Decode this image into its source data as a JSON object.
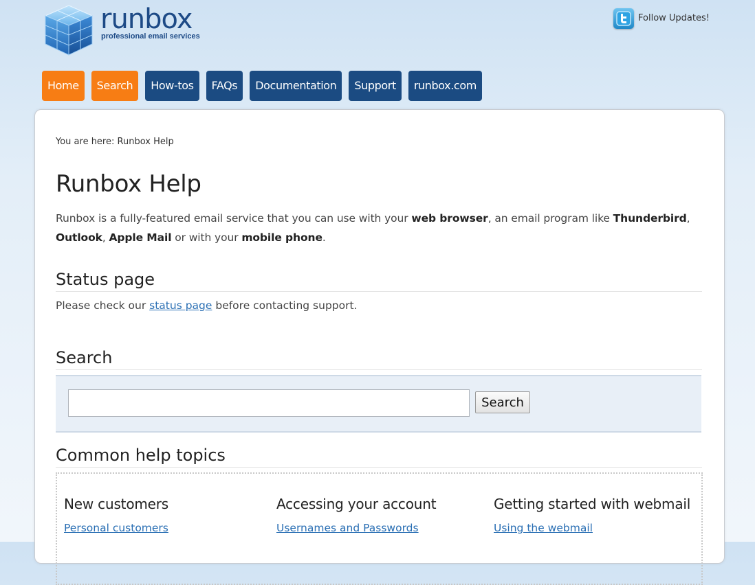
{
  "header": {
    "logo_word": "runbox",
    "logo_tagline": "professional email services",
    "follow_label": "Follow Updates!"
  },
  "nav": {
    "items": [
      {
        "label": "Home",
        "style": "orange"
      },
      {
        "label": "Search",
        "style": "orange"
      },
      {
        "label": "How-tos",
        "style": "blue"
      },
      {
        "label": "FAQs",
        "style": "blue"
      },
      {
        "label": "Documentation",
        "style": "blue"
      },
      {
        "label": "Support",
        "style": "blue"
      },
      {
        "label": "runbox.com",
        "style": "blue"
      }
    ]
  },
  "breadcrumb": {
    "prefix": "You are here: ",
    "current": "Runbox Help"
  },
  "page": {
    "title": "Runbox Help",
    "intro": {
      "t1": "Runbox is a fully-featured email service that you can use with your ",
      "b1": "web browser",
      "t2": ", an email program like ",
      "b2": "Thunderbird",
      "t3": ", ",
      "b3": "Outlook",
      "t4": ", ",
      "b4": "Apple Mail",
      "t5": " or with your ",
      "b5": "mobile phone",
      "t6": "."
    }
  },
  "status": {
    "heading": "Status page",
    "text_before": "Please check our ",
    "link": "status page",
    "text_after": " before contacting support."
  },
  "search": {
    "heading": "Search",
    "input_value": "",
    "button_label": "Search"
  },
  "topics": {
    "heading": "Common help topics",
    "columns": [
      {
        "heading": "New customers",
        "link": "Personal customers"
      },
      {
        "heading": "Accessing your account",
        "link": "Usernames and Passwords"
      },
      {
        "heading": "Getting started with webmail",
        "link": "Using the webmail"
      }
    ]
  },
  "colors": {
    "brand_blue": "#1b4b82",
    "brand_orange": "#f77d14",
    "link": "#2a6fb4"
  }
}
